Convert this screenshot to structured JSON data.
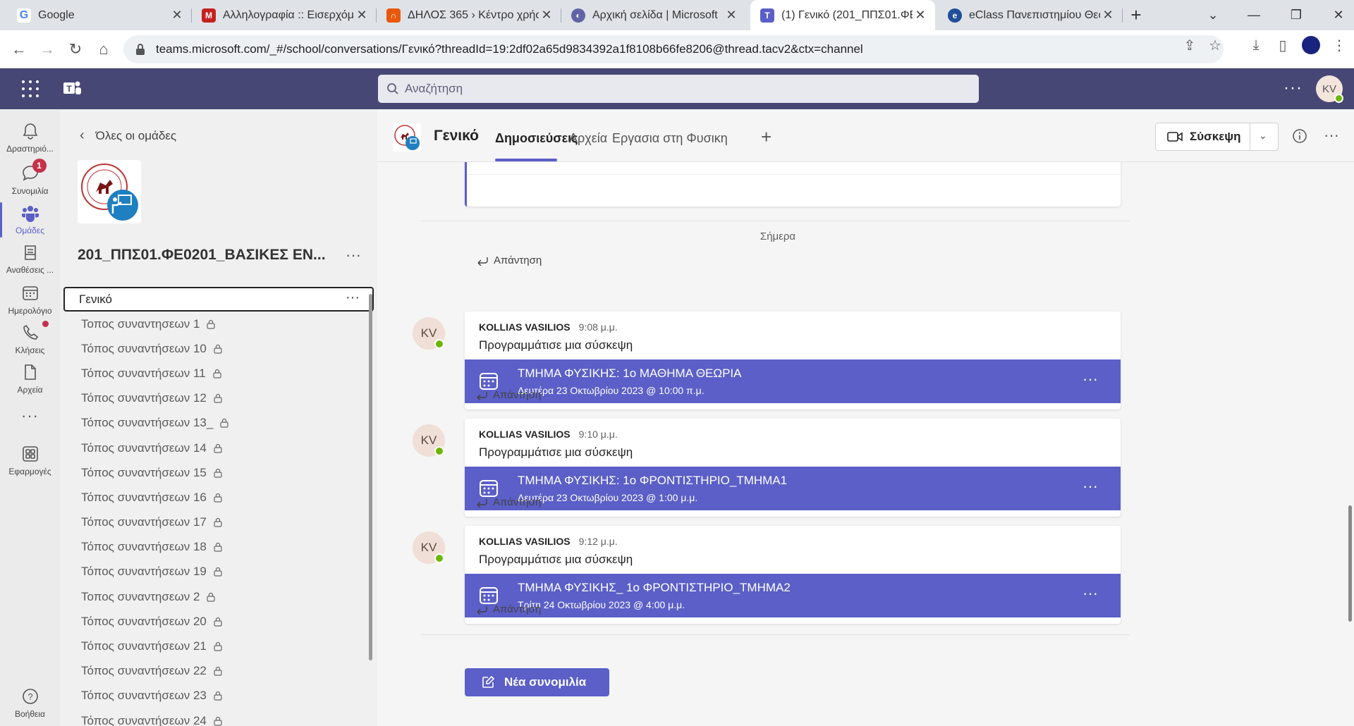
{
  "browser": {
    "tabs": [
      {
        "title": "Google",
        "icon": "google-icon",
        "color": "#4285f4"
      },
      {
        "title": "Αλληλογραφία :: Εισερχόμ",
        "icon": "mail-icon",
        "color": "#c5221f"
      },
      {
        "title": "ΔΗΛΟΣ 365 › Κέντρο χρήσ",
        "icon": "dilos-icon",
        "color": "#e8590c"
      },
      {
        "title": "Αρχική σελίδα | Microsoft",
        "icon": "microsoft-icon",
        "color": "#6264a7"
      },
      {
        "title": "(1) Γενικό (201_ΠΠΣ01.ΦΕ0",
        "icon": "teams-icon",
        "color": "#5b5fc7"
      },
      {
        "title": "eClass Πανεπιστημίου Θεσ",
        "icon": "eclass-icon",
        "color": "#1f4e9a"
      }
    ],
    "url": "teams.microsoft.com/_#/school/conversations/Γενικό?threadId=19:2df02a65d9834392a1f8108b66fe8206@thread.tacv2&ctx=channel"
  },
  "teams": {
    "search_placeholder": "Αναζήτηση",
    "user_initials": "KV"
  },
  "rail": [
    {
      "label": "Δραστηριό...",
      "icon": "bell-icon"
    },
    {
      "label": "Συνομιλία",
      "icon": "chat-icon",
      "badge": "1"
    },
    {
      "label": "Ομάδες",
      "icon": "teams-icon",
      "active": true
    },
    {
      "label": "Αναθέσεις ...",
      "icon": "assignments-icon"
    },
    {
      "label": "Ημερολόγιο",
      "icon": "calendar-icon"
    },
    {
      "label": "Κλήσεις",
      "icon": "phone-icon"
    },
    {
      "label": "Αρχεία",
      "icon": "file-icon"
    },
    {
      "label": "Εφαρμογές",
      "icon": "apps-icon"
    },
    {
      "label": "Βοήθεια",
      "icon": "help-icon"
    }
  ],
  "team_panel": {
    "back_label": "Όλες οι ομάδες",
    "team_name": "201_ΠΠΣ01.ΦΕ0201_ΒΑΣΙΚΕΣ ΕΝ...",
    "selected_channel": "Γενικό",
    "channels": [
      "Τοπος συναντησεων 1",
      "Τόπος συναντήσεων 10",
      "Τόπος συναντήσεων 11",
      "Τόπος συναντήσεων 12",
      "Τόπος συναντήσεων 13_",
      "Τόπος συναντήσεων 14",
      "Τόπος συναντήσεων 15",
      "Τόπος συναντήσεων 16",
      "Τόπος συναντήσεων 17",
      "Τόπος συναντήσεων 18",
      "Τόπος συναντήσεων 19",
      "Τοπος συναντησεων 2",
      "Τόπος συναντήσεων 20",
      "Τόπος συναντήσεων 21",
      "Τόπος συναντήσεων 22",
      "Τόπος συναντήσεων 23",
      "Τόπος συναντήσεων 24"
    ]
  },
  "channel": {
    "name": "Γενικό",
    "tabs": [
      "Δημοσιεύσεις",
      "Αρχεία",
      "Εργασια στη Φυσικη"
    ],
    "meet_label": "Σύσκεψη",
    "reply_label": "Απάντηση",
    "today_label": "Σήμερα",
    "new_conversation_label": "Νέα συνομιλία",
    "messages": [
      {
        "initials": "KV",
        "author": "KOLLIAS VASILIOS",
        "time": "9:08 μ.μ.",
        "text": "Προγραμμάτισε μια σύσκεψη",
        "meeting_title": "ΤΜΗΜΑ ΦΥΣΙΚΗΣ: 1ο ΜΑΘΗΜΑ ΘΕΩΡΙΑ",
        "meeting_date": "Δευτέρα 23 Οκτωβρίου 2023 @ 10:00 π.μ."
      },
      {
        "initials": "KV",
        "author": "KOLLIAS VASILIOS",
        "time": "9:10 μ.μ.",
        "text": "Προγραμμάτισε μια σύσκεψη",
        "meeting_title": "ΤΜΗΜΑ ΦΥΣΙΚΗΣ: 1ο ΦΡΟΝΤΙΣΤΗΡΙΟ_ΤΜΗΜΑ1",
        "meeting_date": "Δευτέρα 23 Οκτωβρίου 2023 @ 1:00 μ.μ."
      },
      {
        "initials": "KV",
        "author": "KOLLIAS VASILIOS",
        "time": "9:12 μ.μ.",
        "text": "Προγραμμάτισε μια σύσκεψη",
        "meeting_title": "ΤΜΗΜΑ ΦΥΣΙΚΗΣ_ 1ο ΦΡΟΝΤΙΣΤΗΡΙΟ_ΤΜΗΜΑ2",
        "meeting_date": "Τρίτη 24 Οκτωβρίου 2023 @ 4:00 μ.μ."
      }
    ]
  },
  "colors": {
    "teams_header": "#464775",
    "accent": "#5b5fc7",
    "presence": "#6bb700",
    "badge": "#c4314b"
  }
}
